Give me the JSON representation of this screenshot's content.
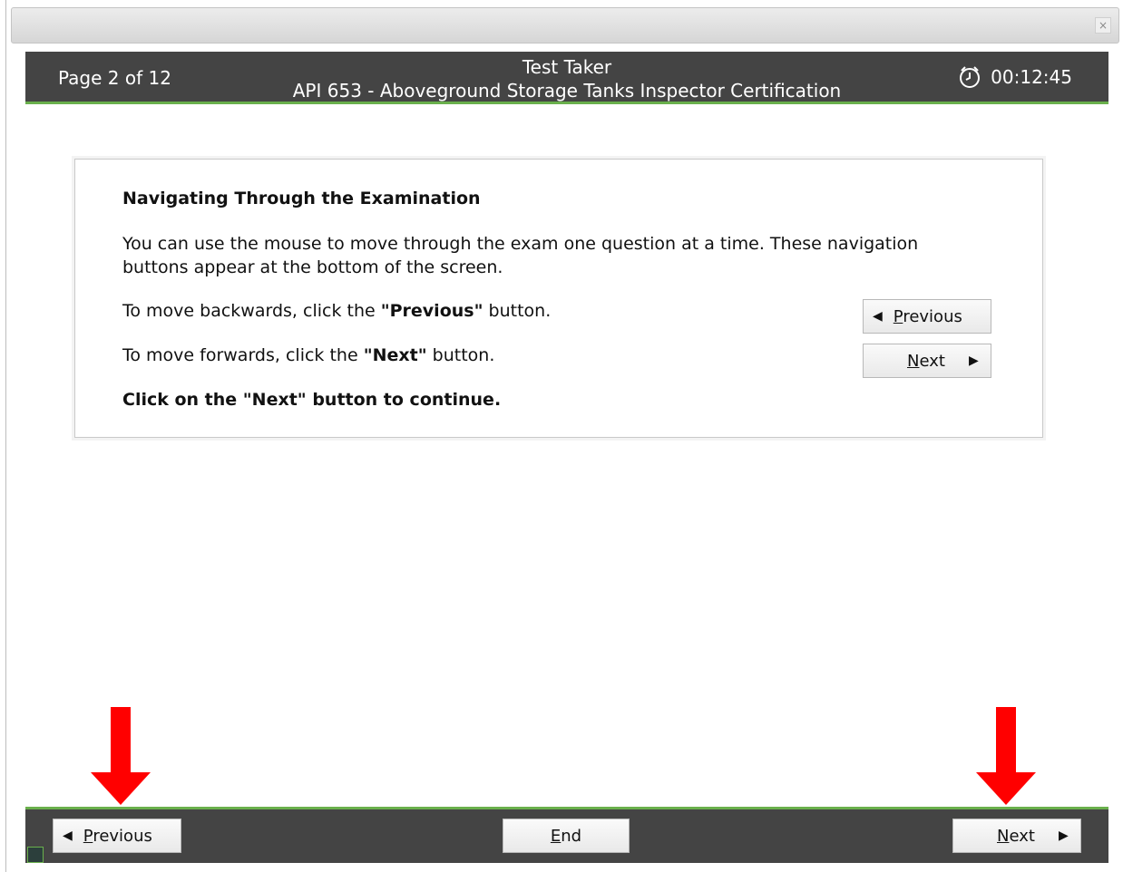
{
  "window": {
    "close_label": "×"
  },
  "header": {
    "page_indicator": "Page 2 of 12",
    "candidate_name": "Test Taker",
    "exam_title": "API 653 - Aboveground Storage Tanks Inspector Certification",
    "timer": "00:12:45"
  },
  "instructions": {
    "heading": "Navigating Through the Examination",
    "paragraph": "You can use the mouse to move through the exam one question at a time. These navigation buttons appear at the bottom of the screen.",
    "prev_prefix": "To move backwards, click the ",
    "prev_bold": "\"Previous\"",
    "prev_suffix": " button.",
    "next_prefix": "To move forwards, click the ",
    "next_bold": "\"Next\"",
    "next_suffix": " button.",
    "continue_text": "Click on the \"Next\" button to continue.",
    "demo_prev_first": "P",
    "demo_prev_rest": "revious",
    "demo_next_first": "N",
    "demo_next_rest": "ext"
  },
  "footer": {
    "prev_first": "P",
    "prev_rest": "revious",
    "end_first": "E",
    "end_rest": "nd",
    "next_first": "N",
    "next_rest": "ext"
  },
  "glyphs": {
    "left_triangle": "◀",
    "right_triangle": "▶"
  },
  "colors": {
    "header_bg": "#444444",
    "accent_green": "#6ab04c",
    "arrow_red": "#ff0000"
  },
  "icons": {
    "timer": "alarm-clock-icon",
    "close": "close-icon"
  }
}
